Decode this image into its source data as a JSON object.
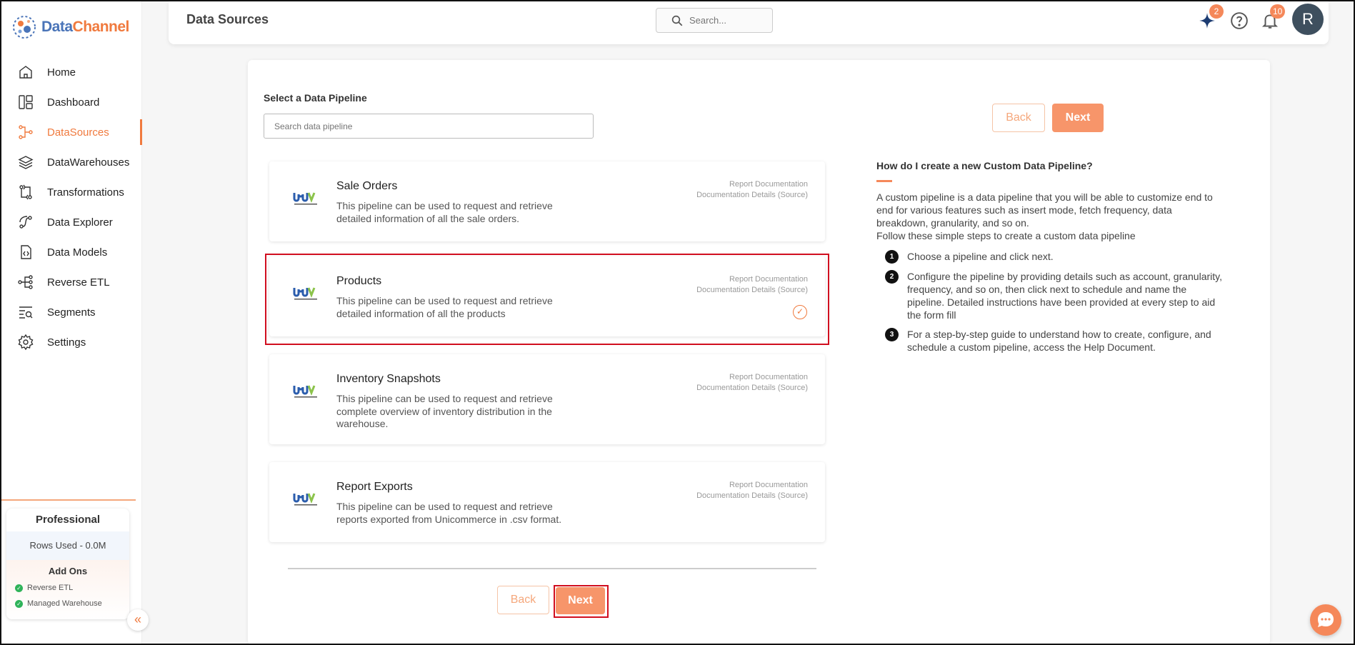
{
  "app": {
    "logo_part1": "Data",
    "logo_part2": "Channel"
  },
  "sidebar": {
    "items": [
      {
        "label": "Home",
        "icon": "home-icon"
      },
      {
        "label": "Dashboard",
        "icon": "dashboard-icon"
      },
      {
        "label": "DataSources",
        "icon": "datasources-icon",
        "active": true
      },
      {
        "label": "DataWarehouses",
        "icon": "layers-icon"
      },
      {
        "label": "Transformations",
        "icon": "transform-icon"
      },
      {
        "label": "Data Explorer",
        "icon": "explorer-icon"
      },
      {
        "label": "Data Models",
        "icon": "data-models-icon"
      },
      {
        "label": "Reverse ETL",
        "icon": "reverse-etl-icon"
      },
      {
        "label": "Segments",
        "icon": "segments-icon"
      },
      {
        "label": "Settings",
        "icon": "gear-icon"
      }
    ],
    "plan": {
      "name": "Professional",
      "rows_used": "Rows Used - 0.0M",
      "addons_title": "Add Ons",
      "addons": [
        "Reverse ETL",
        "Managed Warehouse"
      ]
    },
    "collapse_glyph": "«"
  },
  "header": {
    "title": "Data Sources",
    "search_placeholder": "Search...",
    "sparkle_badge": "2",
    "notification_badge": "10",
    "avatar_initial": "R"
  },
  "main": {
    "select_label": "Select a Data Pipeline",
    "search_placeholder": "Search data pipeline",
    "back_label": "Back",
    "next_label": "Next",
    "pipelines": [
      {
        "name": "Sale Orders",
        "description": "This pipeline can be used to request and retrieve detailed information of all the sale orders.",
        "link1": "Report Documentation",
        "link2": "Documentation Details (Source)",
        "selected": false
      },
      {
        "name": "Products",
        "description": "This pipeline can be used to request and retrieve detailed information of all the products",
        "link1": "Report Documentation",
        "link2": "Documentation Details (Source)",
        "selected": true
      },
      {
        "name": "Inventory Snapshots",
        "description": "This pipeline can be used to request and retrieve complete overview of inventory distribution in the warehouse.",
        "link1": "Report Documentation",
        "link2": "Documentation Details (Source)",
        "selected": false
      },
      {
        "name": "Report Exports",
        "description": "This pipeline can be used to request and retrieve reports exported from Unicommerce in .csv format.",
        "link1": "Report Documentation",
        "link2": "Documentation Details (Source)",
        "selected": false
      }
    ],
    "selected_glyph": "✓"
  },
  "help": {
    "title": "How do I create a new Custom Data Pipeline?",
    "intro": "A custom pipeline is a data pipeline that you will be able to customize end to end for various features such as insert mode, fetch frequency, data breakdown, granularity, and so on.",
    "intro2": "Follow these simple steps to create a custom data pipeline",
    "steps": [
      {
        "num": "1",
        "text": "Choose a pipeline and click next."
      },
      {
        "num": "2",
        "text": "Configure the pipeline by providing details such as account, granularity, frequency, and so on, then click next to schedule and name the pipeline. Detailed instructions have been provided at every step to aid the form fill"
      },
      {
        "num": "3",
        "text": "For a step-by-step guide to understand how to create, configure, and schedule a custom pipeline, access the Help Document."
      }
    ]
  },
  "colors": {
    "accent": "#f07a3e",
    "button": "#f7956a",
    "highlight": "#d10e1f"
  }
}
